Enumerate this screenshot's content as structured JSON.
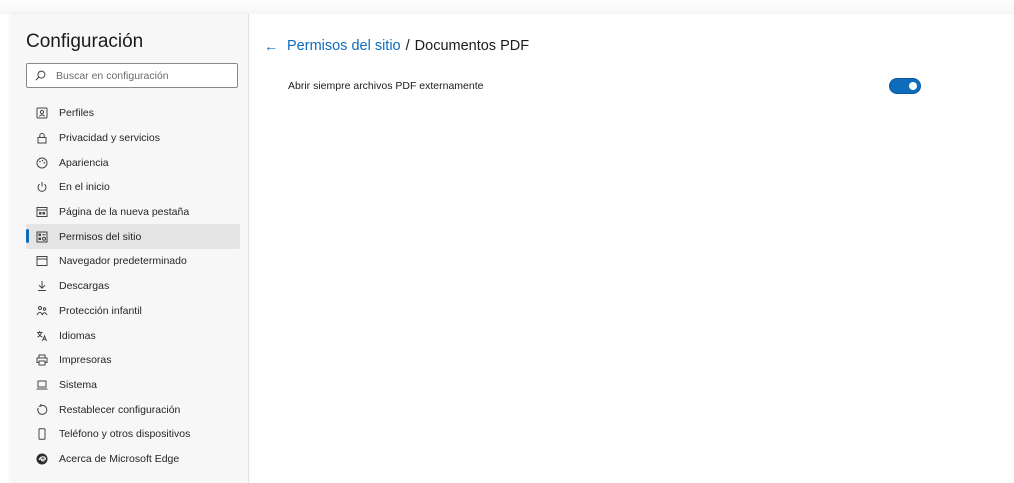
{
  "sidebar": {
    "title": "Configuración",
    "search_placeholder": "Buscar en configuración",
    "items": [
      {
        "label": "Perfiles",
        "icon": "profile-icon"
      },
      {
        "label": "Privacidad y servicios",
        "icon": "lock-icon"
      },
      {
        "label": "Apariencia",
        "icon": "palette-icon"
      },
      {
        "label": "En el inicio",
        "icon": "power-icon"
      },
      {
        "label": "Página de la nueva pestaña",
        "icon": "new-tab-icon"
      },
      {
        "label": "Permisos del sitio",
        "icon": "site-permissions-icon",
        "active": true
      },
      {
        "label": "Navegador predeterminado",
        "icon": "browser-icon"
      },
      {
        "label": "Descargas",
        "icon": "download-icon"
      },
      {
        "label": "Protección infantil",
        "icon": "family-icon"
      },
      {
        "label": "Idiomas",
        "icon": "language-icon"
      },
      {
        "label": "Impresoras",
        "icon": "printer-icon"
      },
      {
        "label": "Sistema",
        "icon": "laptop-icon"
      },
      {
        "label": "Restablecer configuración",
        "icon": "reset-icon"
      },
      {
        "label": "Teléfono y otros dispositivos",
        "icon": "phone-icon"
      },
      {
        "label": "Acerca de Microsoft Edge",
        "icon": "edge-logo-icon"
      }
    ]
  },
  "main": {
    "breadcrumb_parent": "Permisos del sitio",
    "breadcrumb_separator": "/",
    "breadcrumb_current": "Documentos PDF",
    "setting_label": "Abrir siempre archivos PDF externamente",
    "setting_enabled": true
  },
  "colors": {
    "accent": "#0f6cbd",
    "sidebar_bg": "#f7f7f7",
    "active_item_bg": "#e4e4e4"
  }
}
